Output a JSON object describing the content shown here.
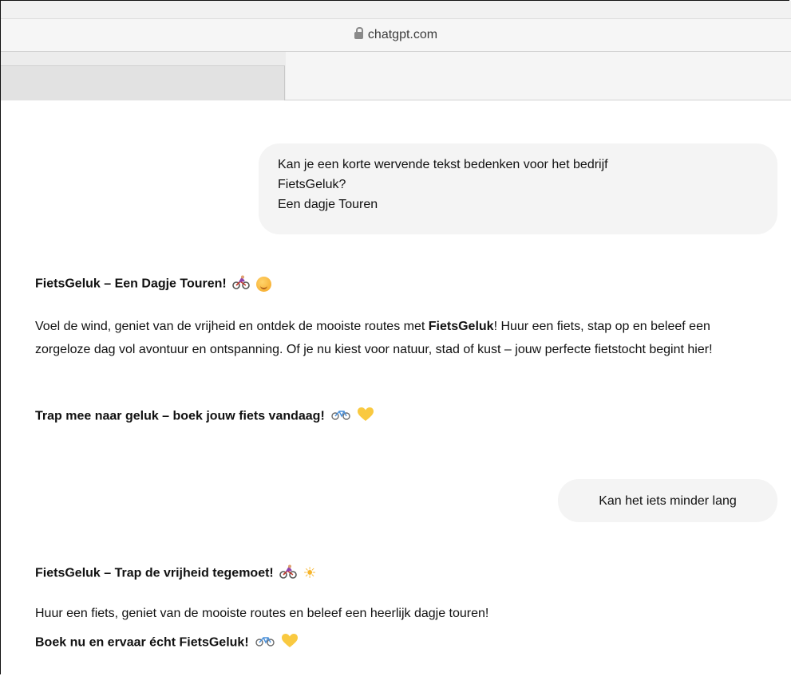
{
  "browser": {
    "url": "chatgpt.com",
    "icons": {
      "lock": "lock-icon"
    }
  },
  "conversation": {
    "messages": [
      {
        "role": "user",
        "text": "Kan je een korte wervende tekst bedenken voor het bedrijf\nFietsGeluk?\nEen dagje Touren"
      },
      {
        "role": "assistant",
        "title": "FietsGeluk – Een Dagje Touren!",
        "title_emojis": [
          "cyclist-icon",
          "smile-icon"
        ],
        "body_before": "Voel de wind, geniet van de vrijheid en ontdek de mooiste routes met ",
        "body_bold": "FietsGeluk",
        "body_after": "! Huur een fiets, stap op en beleef een zorgeloze dag vol avontuur en ontspanning. Of je nu kiest voor natuur, stad of kust – jouw perfecte fietstocht begint hier!",
        "cta": "Trap mee naar geluk – boek jouw fiets vandaag!",
        "cta_emojis": [
          "bicycle-icon",
          "yellow-heart-icon"
        ]
      },
      {
        "role": "user",
        "text": "Kan het iets minder lang"
      },
      {
        "role": "assistant",
        "title": "FietsGeluk – Trap de vrijheid tegemoet!",
        "title_emojis": [
          "cyclist-icon",
          "sun-icon"
        ],
        "body": "Huur een fiets, geniet van de mooiste routes en beleef een heerlijk dagje touren!",
        "cta": "Boek nu en ervaar écht FietsGeluk!",
        "cta_emojis": [
          "bicycle-icon",
          "yellow-heart-icon"
        ]
      }
    ]
  },
  "colors": {
    "user_bubble": "#f4f4f4",
    "text": "#0d0d0d",
    "heart": "#f9c940",
    "cyclist_shirt": "#8e44ad"
  }
}
